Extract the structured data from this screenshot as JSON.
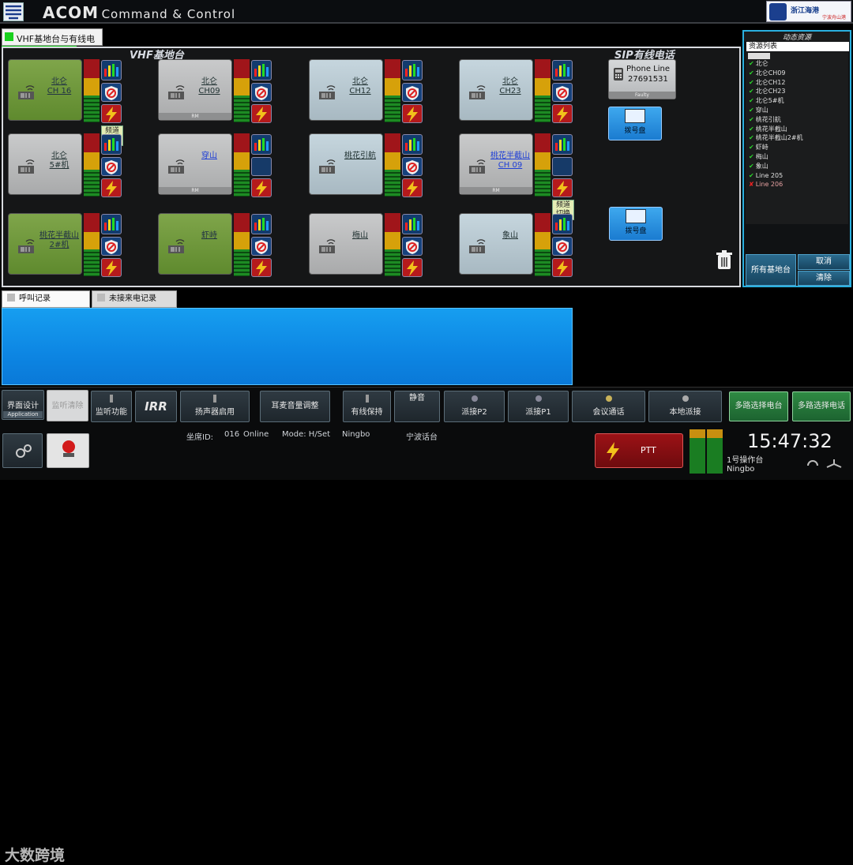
{
  "app": {
    "title_big": "ACOM",
    "title_small": "Command & Control",
    "brand_name": "浙江海港",
    "brand_sub": "宁波舟山港"
  },
  "top_tab": {
    "label": "VHF基地台与有线电话"
  },
  "vhf_section": {
    "title": "VHF基地台"
  },
  "sip_section": {
    "title": "SIP有线电话"
  },
  "tiles": [
    {
      "line1": "北仑",
      "line2": "CH 16",
      "color": "green",
      "rm": false,
      "switch": true
    },
    {
      "line1": "北仑",
      "line2": "CH09",
      "color": "gray",
      "rm": true,
      "switch": false
    },
    {
      "line1": "北仑",
      "line2": "CH12",
      "color": "blue",
      "rm": false,
      "switch": false
    },
    {
      "line1": "北仑",
      "line2": "CH23",
      "color": "blue",
      "rm": false,
      "switch": false
    },
    {
      "line1": "北仑",
      "line2": "5#机",
      "color": "gray",
      "rm": false,
      "switch": false
    },
    {
      "line1": "穿山",
      "line2": "",
      "color": "gray",
      "rm": true,
      "switch": false
    },
    {
      "line1": "桃花引航",
      "line2": "",
      "color": "blue",
      "rm": false,
      "switch": false
    },
    {
      "line1": "桃花半截山",
      "line2": "CH 09",
      "color": "gray",
      "rm": true,
      "switch": true
    },
    {
      "line1": "桃花半截山",
      "line2": "2#机",
      "color": "green",
      "rm": false,
      "switch": false
    },
    {
      "line1": "虾峙",
      "line2": "",
      "color": "green",
      "rm": false,
      "switch": false
    },
    {
      "line1": "梅山",
      "line2": "",
      "color": "gray",
      "rm": false,
      "switch": false
    },
    {
      "line1": "象山",
      "line2": "",
      "color": "blue",
      "rm": false,
      "switch": false
    }
  ],
  "switch_label": [
    "频道",
    "切换"
  ],
  "rm_label": "RM",
  "phone": {
    "line1": "Phone Line",
    "line2": "27691531",
    "status": "Faulty"
  },
  "dialpad_label": "拨号盘",
  "resources": {
    "header": "动态资源",
    "list_title": "资源列表",
    "items": [
      {
        "label": "北仑",
        "ok": true
      },
      {
        "label": "北仑CH09",
        "ok": true
      },
      {
        "label": "北仑CH12",
        "ok": true
      },
      {
        "label": "北仑CH23",
        "ok": true
      },
      {
        "label": "北仑5#机",
        "ok": true
      },
      {
        "label": "穿山",
        "ok": true
      },
      {
        "label": "桃花引航",
        "ok": true
      },
      {
        "label": "桃花半截山",
        "ok": true
      },
      {
        "label": "桃花半截山2#机",
        "ok": true
      },
      {
        "label": "虾峙",
        "ok": true
      },
      {
        "label": "梅山",
        "ok": true
      },
      {
        "label": "象山",
        "ok": true
      },
      {
        "label": "Line 205",
        "ok": true
      },
      {
        "label": "Line 206",
        "ok": false
      }
    ],
    "all_button": "所有基地台",
    "cancel_button": "取消",
    "clear_button": "清除"
  },
  "call_tabs": {
    "calls": "呼叫记录",
    "missed": "未接来电记录"
  },
  "bottom": {
    "ui_design": "界面设计",
    "application": "Application",
    "monitor_clear": "监听清除",
    "monitor_func": "监听功能",
    "irr": "IRR",
    "speaker": "扬声器启用",
    "mic_volume": "耳麦音量调整",
    "hold": "有线保持",
    "mute": "静音",
    "dispatch_p2": "派接P2",
    "dispatch_p1": "派接P1",
    "conference": "会议通话",
    "local_dispatch": "本地派接",
    "multi_base": "多路选择电台",
    "multi_phone": "多路选择电话",
    "seat_id_label": "坐席ID:",
    "seat_id": "016",
    "online": "Online",
    "mode": "Mode: H/Set",
    "site": "Ningbo",
    "station": "宁波话台",
    "ptt": "PTT",
    "clock": "15:47:32",
    "console": "1号操作台",
    "city": "Ningbo",
    "watermark": "大数跨境"
  }
}
